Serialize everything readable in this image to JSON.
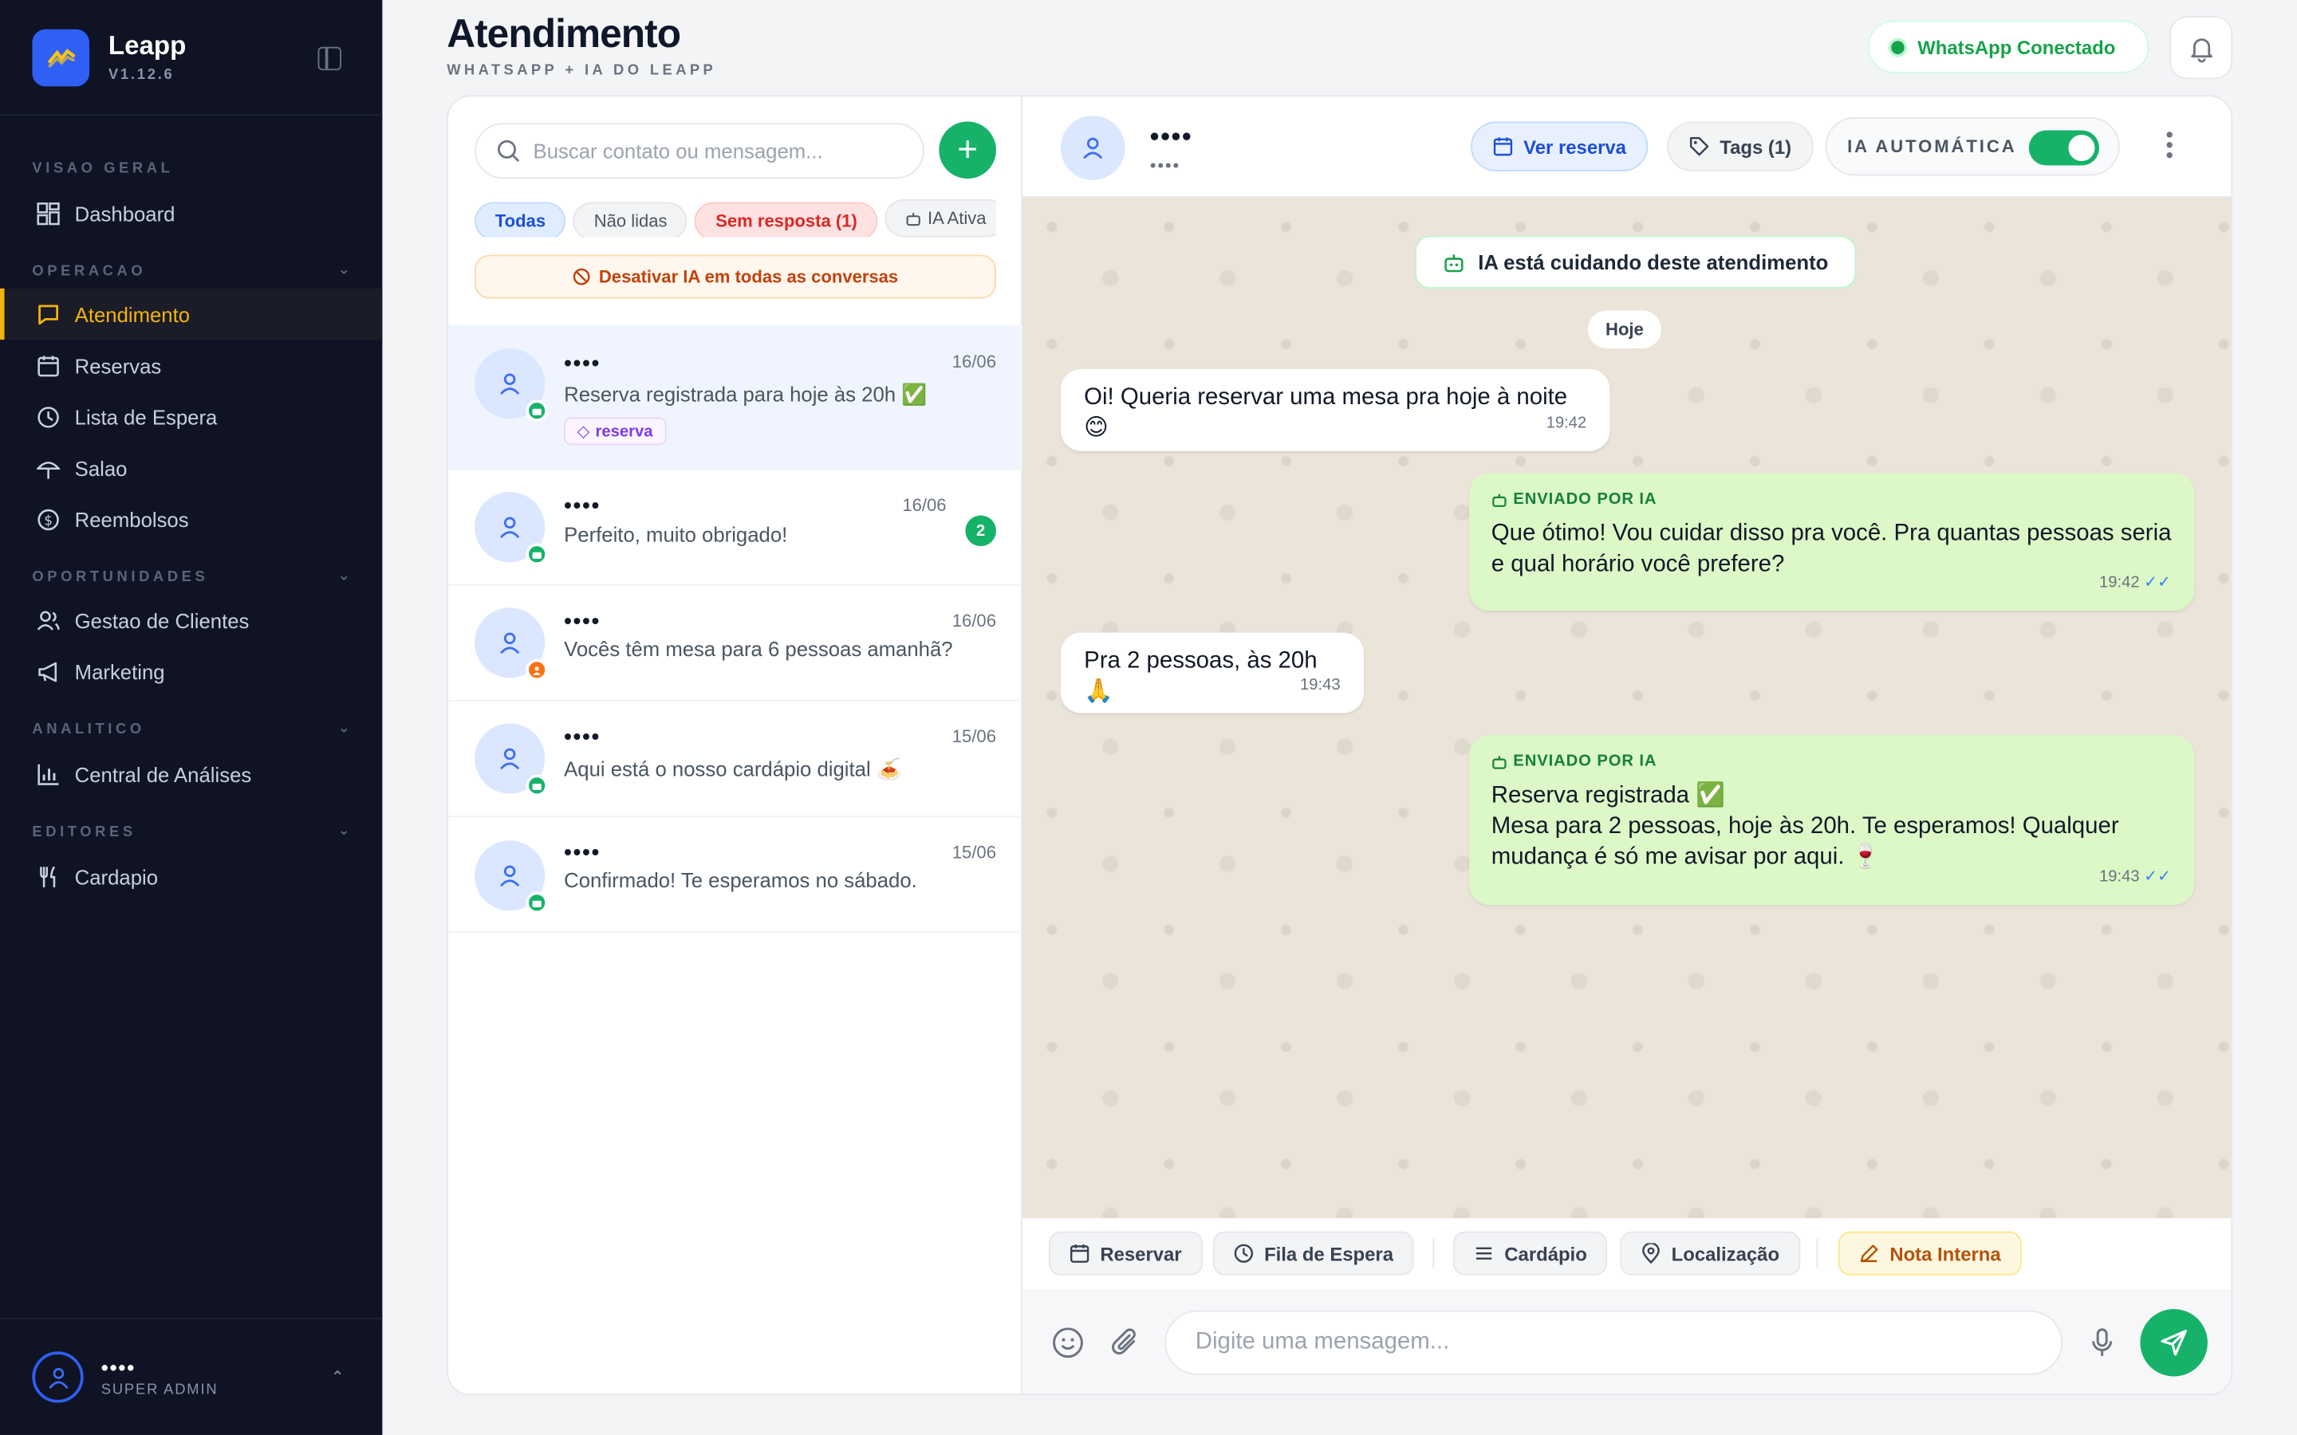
{
  "brand": {
    "name": "Leapp",
    "version": "V1.12.6"
  },
  "nav": {
    "sections": [
      {
        "label": "VISAO GERAL"
      },
      {
        "label": "OPERACAO"
      },
      {
        "label": "OPORTUNIDADES"
      },
      {
        "label": "ANALITICO"
      },
      {
        "label": "EDITORES"
      }
    ],
    "items": [
      {
        "label": "Dashboard",
        "icon": "grid-icon"
      },
      {
        "label": "Atendimento",
        "icon": "chat-icon",
        "active": true
      },
      {
        "label": "Reservas",
        "icon": "calendar-icon"
      },
      {
        "label": "Lista de Espera",
        "icon": "clock-icon"
      },
      {
        "label": "Salao",
        "icon": "umbrella-icon"
      },
      {
        "label": "Reembolsos",
        "icon": "dollar-icon"
      },
      {
        "label": "Gestao de Clientes",
        "icon": "users-icon"
      },
      {
        "label": "Marketing",
        "icon": "megaphone-icon"
      },
      {
        "label": "Central de Análises",
        "icon": "bar-chart-icon"
      },
      {
        "label": "Cardapio",
        "icon": "fork-knife-icon"
      }
    ]
  },
  "user": {
    "name": "••••",
    "role": "SUPER ADMIN"
  },
  "header": {
    "title": "Atendimento",
    "subtitle": "WHATSAPP + IA DO LEAPP",
    "wa_status": "WhatsApp Conectado"
  },
  "list": {
    "search_placeholder": "Buscar contato ou mensagem...",
    "filters": [
      "Todas",
      "Não lidas",
      "Sem resposta (1)",
      "IA Ativa"
    ],
    "disable_ai": "Desativar IA em todas as conversas",
    "conversations": [
      {
        "name": "••••",
        "date": "16/06",
        "message": "Reserva registrada para hoje às 20h ✅",
        "tag": "reserva"
      },
      {
        "name": "••••",
        "date": "16/06",
        "message": "Perfeito, muito obrigado!",
        "unread": "2"
      },
      {
        "name": "••••",
        "date": "16/06",
        "message": "Vocês têm mesa para 6 pessoas amanhã?"
      },
      {
        "name": "••••",
        "date": "15/06",
        "message": "Aqui está o nosso cardápio digital 🍝"
      },
      {
        "name": "••••",
        "date": "15/06",
        "message": "Confirmado! Te esperamos no sábado."
      }
    ]
  },
  "chat": {
    "contact_name": "••••",
    "contact_phone": "••••",
    "btn_reserva": "Ver reserva",
    "btn_tags": "Tags (1)",
    "ia_auto_label": "IA AUTOMÁTICA",
    "ia_auto_on": true,
    "ia_banner": "IA está cuidando deste atendimento",
    "day": "Hoje",
    "ai_label": "ENVIADO POR IA",
    "messages": [
      {
        "dir": "in",
        "text": "Oi! Queria reservar uma mesa pra hoje à noite 😊",
        "time": "19:42"
      },
      {
        "dir": "out",
        "text": "Que ótimo! Vou cuidar disso pra você. Pra quantas pessoas seria e qual horário você prefere?",
        "time": "19:42"
      },
      {
        "dir": "in",
        "text": "Pra 2 pessoas, às 20h🙏",
        "time": "19:43"
      },
      {
        "dir": "out",
        "text_line1": "Reserva registrada ✅",
        "text_line2": "Mesa para 2 pessoas, hoje às 20h. Te esperamos! Qualquer mudança é só me avisar por aqui. 🍷",
        "time": "19:43"
      }
    ],
    "quick_actions": [
      "Reservar",
      "Fila de Espera",
      "Cardápio",
      "Localização",
      "Nota Interna"
    ],
    "composer_placeholder": "Digite uma mensagem..."
  },
  "colors": {
    "accent": "#16b26a",
    "brand": "#2f5ff5",
    "sidebar_bg": "#0f1324",
    "active_nav": "#f5b40b"
  }
}
